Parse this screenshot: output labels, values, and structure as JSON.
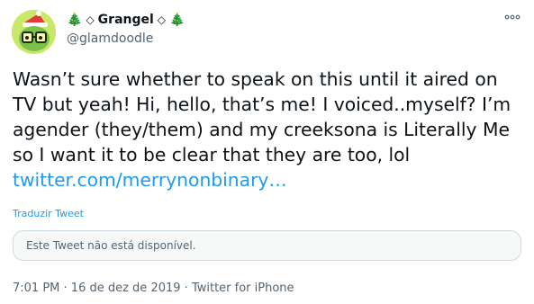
{
  "author": {
    "emoji_left": "🎄",
    "decor_left": "◇",
    "display_name": "Grangel",
    "decor_right": "◇",
    "emoji_right": "🎄",
    "handle": "@glamdoodle",
    "avatar_icon": "avatar-icon"
  },
  "tweet": {
    "text": "Wasn’t sure whether to speak on this until it aired on TV but yeah! Hi, hello, that’s me! I voiced..myself? I’m agender (they/them) and my creeksona is Literally Me so I want it to be clear that they are too, lol ",
    "link": "twitter.com/merrynonbinary…",
    "translate_label": "Traduzir Tweet",
    "quoted_unavailable": "Este Tweet não está disponível."
  },
  "meta": {
    "time": "7:01 PM",
    "sep1": " · ",
    "date": "16 de dez de 2019",
    "sep2": " · ",
    "source": "Twitter for iPhone"
  },
  "colors": {
    "accent": "#1d9bf0",
    "secondary_text": "#536471",
    "avatar_bg": "#c8e86a"
  }
}
